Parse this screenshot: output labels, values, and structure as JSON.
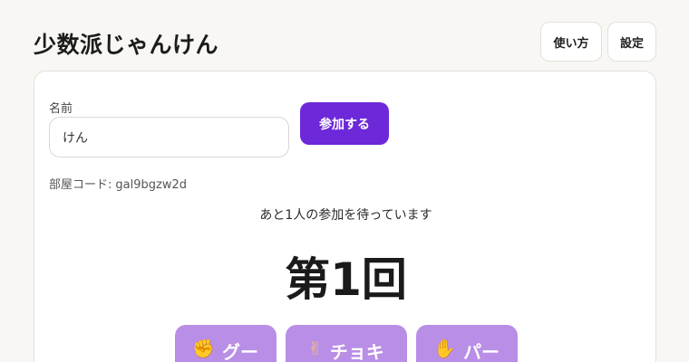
{
  "header": {
    "title": "少数派じゃんけん",
    "howto_label": "使い方",
    "settings_label": "設定"
  },
  "form": {
    "name_label": "名前",
    "name_value": "けん",
    "join_label": "参加する"
  },
  "room": {
    "code_label": "部屋コード:",
    "code_value": "gal9bgzw2d"
  },
  "status": {
    "waiting_text": "あと1人の参加を待っています"
  },
  "game": {
    "round_label": "第1回",
    "hands": [
      {
        "icon": "✊",
        "label": "グー"
      },
      {
        "icon": "✌",
        "label": "チョキ"
      },
      {
        "icon": "✋",
        "label": "パー"
      }
    ]
  },
  "colors": {
    "accent": "#6d28d9",
    "hand_button": "#b98ee6",
    "background": "#f8f7f4"
  }
}
